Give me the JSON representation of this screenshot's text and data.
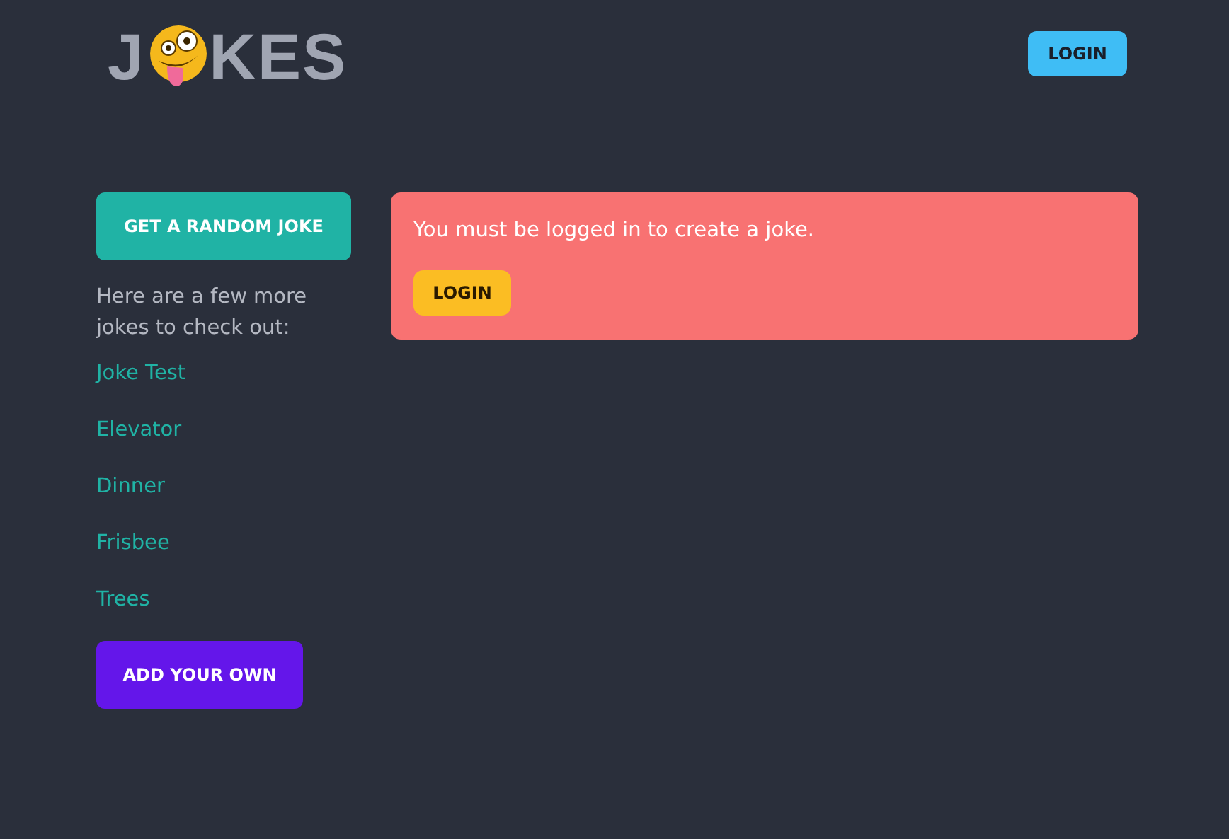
{
  "header": {
    "logo": {
      "before": "J",
      "after": "KES"
    },
    "login_button": "LOGIN"
  },
  "sidebar": {
    "random_button": "GET A RANDOM JOKE",
    "intro": "Here are a few more jokes to check out:",
    "jokes": [
      "Joke Test",
      "Elevator",
      "Dinner",
      "Frisbee",
      "Trees"
    ],
    "add_button": "ADD YOUR OWN"
  },
  "alert": {
    "message": "You must be logged in to create a joke.",
    "button": "LOGIN"
  }
}
